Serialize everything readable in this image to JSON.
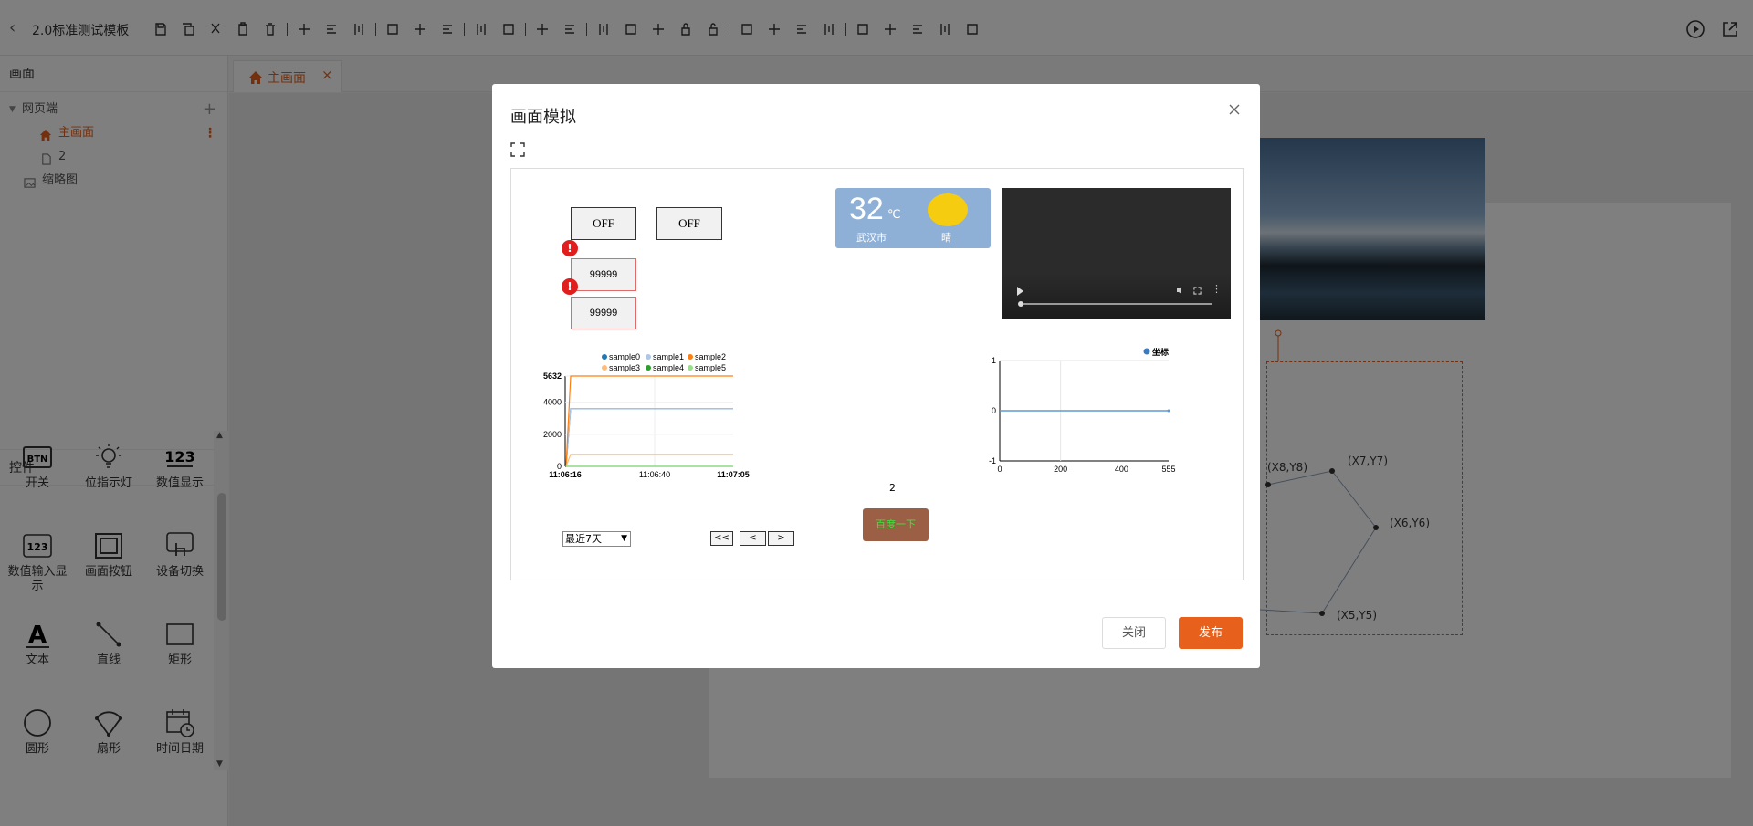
{
  "app": {
    "title": "2.0标准测试模板"
  },
  "toolbar": {
    "icons": [
      "save-icon",
      "copy-icon",
      "cut-icon",
      "paste-icon",
      "delete-icon",
      "align-left-icon",
      "align-center-icon",
      "align-right-icon",
      "align-top-icon",
      "align-bottom-icon",
      "align-middle-icon",
      "distribute-h-icon",
      "distribute-v-icon",
      "group-icon",
      "ungroup-icon",
      "layout-icon",
      "rotate-icon",
      "clone-icon",
      "lock-icon",
      "unlock-icon",
      "link-icon",
      "unlink-icon",
      "bring-front-icon",
      "send-back-icon",
      "undo-icon",
      "redo-icon",
      "image-icon",
      "component-icon",
      "video-icon"
    ],
    "right_icons": [
      "play-icon",
      "external-link-icon"
    ]
  },
  "left_panel": {
    "screens_header": "画面",
    "tree": {
      "group_label": "网页端",
      "items": [
        {
          "label": "主画面",
          "active": true
        },
        {
          "label": "2",
          "active": false
        }
      ],
      "thumbnail_label": "缩略图"
    },
    "controls_header": "控件",
    "controls": [
      {
        "label": "开关",
        "icon": "btn-icon"
      },
      {
        "label": "位指示灯",
        "icon": "lightbulb-icon"
      },
      {
        "label": "数值显示",
        "icon": "number-display-icon"
      },
      {
        "label": "数值输入显示",
        "icon": "number-input-icon"
      },
      {
        "label": "画面按钮",
        "icon": "screen-button-icon"
      },
      {
        "label": "设备切换",
        "icon": "device-switch-icon"
      },
      {
        "label": "文本",
        "icon": "text-icon"
      },
      {
        "label": "直线",
        "icon": "line-icon"
      },
      {
        "label": "矩形",
        "icon": "rectangle-icon"
      },
      {
        "label": "圆形",
        "icon": "circle-icon"
      },
      {
        "label": "扇形",
        "icon": "sector-icon"
      },
      {
        "label": "时间日期",
        "icon": "calendar-icon"
      }
    ]
  },
  "tabs": [
    {
      "label": "主画面",
      "close": "×"
    }
  ],
  "canvas_bg": {
    "polygon_labels": [
      "(X8,Y8)",
      "(X7,Y7)",
      "(X6,Y6)",
      "(X5,Y5)"
    ]
  },
  "modal": {
    "title": "画面模拟",
    "switch_buttons": [
      "OFF",
      "OFF"
    ],
    "numeric_values": [
      "99999",
      "99999"
    ],
    "error_mark": "!",
    "weather": {
      "temperature": "32",
      "unit": "℃",
      "city": "武汉市",
      "condition": "晴"
    },
    "count_text": "2",
    "link_button": "百度一下",
    "range_select": "最近7天",
    "nav_buttons": [
      "<<",
      "<",
      ">"
    ],
    "footer": {
      "close_label": "关闭",
      "publish_label": "发布"
    }
  },
  "chart_data": [
    {
      "type": "line",
      "x": [
        "11:06:16",
        "11:06:40",
        "11:07:05"
      ],
      "xlabel": "",
      "ylabel": "",
      "ylim": [
        0,
        5632
      ],
      "yticks": [
        0,
        2000,
        4000,
        5632
      ],
      "legend": "top",
      "grid": true,
      "series": [
        {
          "name": "sample0",
          "color": "#1f77b4",
          "values": [
            0,
            3600,
            3600
          ]
        },
        {
          "name": "sample1",
          "color": "#aec7e8",
          "values": [
            0,
            3600,
            3600
          ]
        },
        {
          "name": "sample2",
          "color": "#ff7f0e",
          "values": [
            0,
            5632,
            5632
          ]
        },
        {
          "name": "sample3",
          "color": "#ffbb78",
          "values": [
            0,
            750,
            750
          ]
        },
        {
          "name": "sample4",
          "color": "#2ca02c",
          "values": [
            0,
            0,
            0
          ]
        },
        {
          "name": "sample5",
          "color": "#98df8a",
          "values": [
            0,
            0,
            0
          ]
        }
      ]
    },
    {
      "type": "line",
      "x": [
        0,
        555
      ],
      "xticks": [
        0,
        200,
        400,
        555
      ],
      "ylim": [
        -1,
        1
      ],
      "yticks": [
        -1,
        0,
        1
      ],
      "legend": "top-right",
      "grid": true,
      "series": [
        {
          "name": "坐标",
          "color": "#5b9bd5",
          "values": [
            0,
            0
          ]
        }
      ]
    }
  ]
}
